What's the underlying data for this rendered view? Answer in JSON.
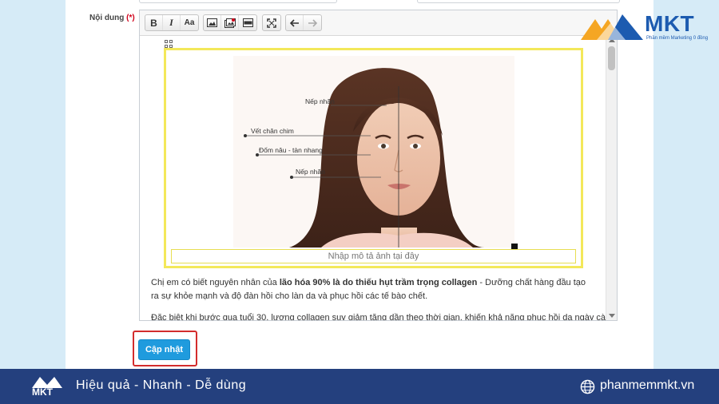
{
  "form": {
    "field_label": "Nội dung",
    "required_mark": "(*)"
  },
  "toolbar": {
    "bold": "B",
    "italic": "I",
    "font_size": "Aa",
    "image_icon": "image-icon",
    "gallery_icon": "image-gallery-icon",
    "layout_icon": "layout-icon",
    "fullscreen_icon": "fullscreen-icon",
    "undo_icon": "undo-icon",
    "redo_icon": "redo-icon"
  },
  "figure": {
    "labels": [
      "Nếp nhăn",
      "Vết chân chim",
      "Đốm nâu - tàn nhang",
      "Nếp nhăn"
    ],
    "caption_placeholder": "Nhập mô tả ảnh tại đây"
  },
  "content": {
    "p1_a": "Chị em có biết nguyên nhân của ",
    "p1_bold": "lão hóa 90% là do thiếu hụt trầm trọng collagen",
    "p1_b": " - Dưỡng chất hàng đầu tạo ra sự khỏe mạnh và độ đàn hồi cho làn da và phục hồi các tế bào chết.",
    "p2": "Đặc biệt khi bước qua tuổi 30, lượng collagen suy giảm tăng dần theo thời gian, khiến khả năng phục hồi da ngày càng"
  },
  "actions": {
    "update_label": "Cập nhật"
  },
  "brand": {
    "logo_text": "MKT",
    "tagline": "Phần mềm Marketing 0 đồng",
    "slogan": "Hiệu quả - Nhanh - Dễ dùng",
    "website": "phanmemmkt.vn",
    "colors": {
      "primary": "#24407e",
      "accent": "#f5a623",
      "button": "#1f9bde",
      "highlight": "#d32c2c"
    }
  }
}
